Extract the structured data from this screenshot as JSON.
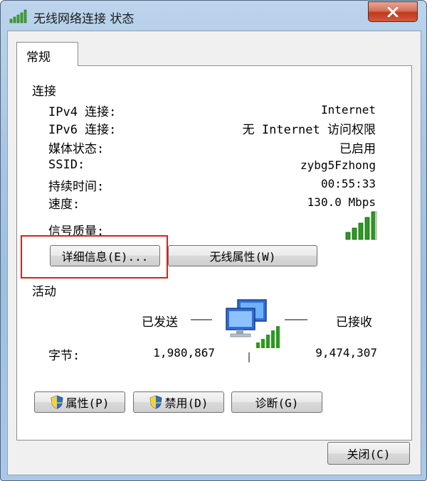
{
  "window": {
    "title": "无线网络连接 状态",
    "close_icon": "close-icon"
  },
  "tab": {
    "label": "常规"
  },
  "connection": {
    "group_label": "连接",
    "rows": [
      {
        "label": "IPv4 连接:",
        "value": "Internet"
      },
      {
        "label": "IPv6 连接:",
        "value": "无 Internet 访问权限"
      },
      {
        "label": "媒体状态:",
        "value": "已启用"
      },
      {
        "label": "SSID:",
        "value": "zybg5Fzhong"
      },
      {
        "label": "持续时间:",
        "value": "00:55:33"
      },
      {
        "label": "速度:",
        "value": "130.0 Mbps"
      }
    ],
    "signal_label": "信号质量:",
    "signal_bars_lit": 5,
    "signal_bars_total": 5,
    "details_button": "详细信息(E)...",
    "wireless_props_button": "无线属性(W)"
  },
  "activity": {
    "group_label": "活动",
    "sent_label": "已发送",
    "received_label": "已接收",
    "bytes_label": "字节:",
    "bytes_sent": "1,980,867",
    "bytes_received": "9,474,307"
  },
  "buttons": {
    "properties": "属性(P)",
    "disable": "禁用(D)",
    "diagnose": "诊断(G)",
    "close": "关闭(C)"
  },
  "colors": {
    "signal_green": "#2a9a1f",
    "highlight_red": "#d22222",
    "frame_blue": "#a9c6e4"
  }
}
